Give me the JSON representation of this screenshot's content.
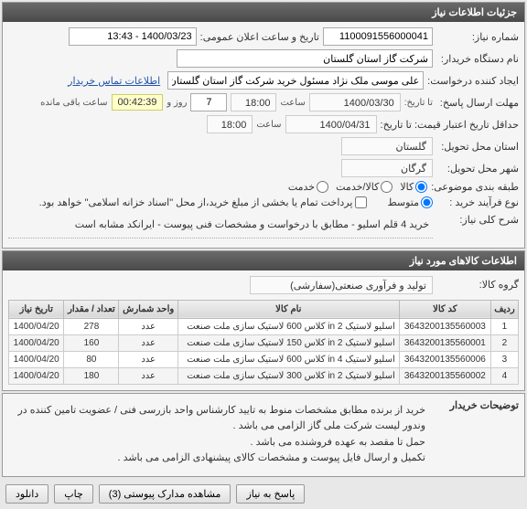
{
  "header": {
    "title": "جزئیات اطلاعات نیاز"
  },
  "info": {
    "number_label": "شماره نیاز:",
    "number_value": "1100091556000041",
    "announce_label": "تاریخ و ساعت اعلان عمومی:",
    "announce_value": "1400/03/23 - 13:43",
    "buyer_org_label": "نام دستگاه خریدار:",
    "buyer_org_value": "شرکت گاز استان گلستان",
    "creator_label": "ایجاد کننده درخواست:",
    "creator_value": "علی موسی ملک نژاد مسئول خرید شرکت گاز استان گلستان",
    "contact_link": "اطلاعات تماس خریدار",
    "deadline_label": "مهلت ارسال پاسخ:",
    "until_label": "تا تاریخ:",
    "deadline_date": "1400/03/30",
    "time_lbl": "ساعت",
    "deadline_time": "18:00",
    "days_value": "7",
    "days_label": "روز و",
    "countdown": "00:42:39",
    "remaining_label": "ساعت باقی مانده",
    "valid_until_label": "حداقل تاریخ اعتبار قیمت: تا تاریخ:",
    "valid_date": "1400/04/31",
    "valid_time": "18:00",
    "province_label": "استان محل تحویل:",
    "province_value": "گلستان",
    "city_label": "شهر محل تحویل:",
    "city_value": "گرگان",
    "classification_label": "طبقه بندی موضوعی:",
    "class_kala": "کالا",
    "class_service": "کالا/خدمت",
    "class_khidmat": "خدمت",
    "process_label": "نوع فرآیند خرید :",
    "process_mid": "متوسط",
    "treasury_note": "پرداخت تمام یا بخشی از مبلغ خرید،از محل \"اسناد خزانه اسلامی\" خواهد بود.",
    "desc_label": "شرح کلی نیاز:",
    "desc_text": "خرید 4 قلم اسلیو - مطابق با درخواست و مشخصات فنی پیوست - ایرانکد مشابه است"
  },
  "items": {
    "header": "اطلاعات کالاهای مورد نیاز",
    "group_label": "گروه کالا:",
    "group_value": "تولید و فرآوری صنعتی(سفارشی)",
    "columns": {
      "row": "ردیف",
      "code": "کد کالا",
      "name": "نام کالا",
      "unit": "واحد شمارش",
      "qty": "تعداد / مقدار",
      "date": "تاریخ نیاز"
    },
    "rows": [
      {
        "n": "1",
        "code": "3643200135560003",
        "name": "اسلیو لاستیک 2 in کلاس 600 لاستیک سازی ملت صنعت",
        "unit": "عدد",
        "qty": "278",
        "date": "1400/04/20"
      },
      {
        "n": "2",
        "code": "3643200135560001",
        "name": "اسلیو لاستیک 2 in کلاس 150 لاستیک سازی ملت صنعت",
        "unit": "عدد",
        "qty": "160",
        "date": "1400/04/20"
      },
      {
        "n": "3",
        "code": "3643200135560006",
        "name": "اسلیو لاستیک 4 in کلاس 600 لاستیک سازی ملت صنعت",
        "unit": "عدد",
        "qty": "80",
        "date": "1400/04/20"
      },
      {
        "n": "4",
        "code": "3643200135560002",
        "name": "اسلیو لاستیک 2 in کلاس 300 لاستیک سازی ملت صنعت",
        "unit": "عدد",
        "qty": "180",
        "date": "1400/04/20"
      }
    ]
  },
  "notes": {
    "label": "توضیحات خریدار",
    "text": "خرید از برنده مطابق مشخصات منوط به تایید کارشناس واحد بازرسی فنی / عضویت تامین کننده در وندور لیست شرکت ملی گاز الزامی می باشد .\nحمل تا مقصد به عهده فروشنده می باشد .\nتکمیل و ارسال فایل پیوست و مشخصات کالای پیشنهادی الزامی می باشد ."
  },
  "footer": {
    "attachments": "مشاهده مدارک پیوستی (3)",
    "print": "چاپ",
    "export": "دانلود",
    "response": "پاسخ به نیاز"
  }
}
